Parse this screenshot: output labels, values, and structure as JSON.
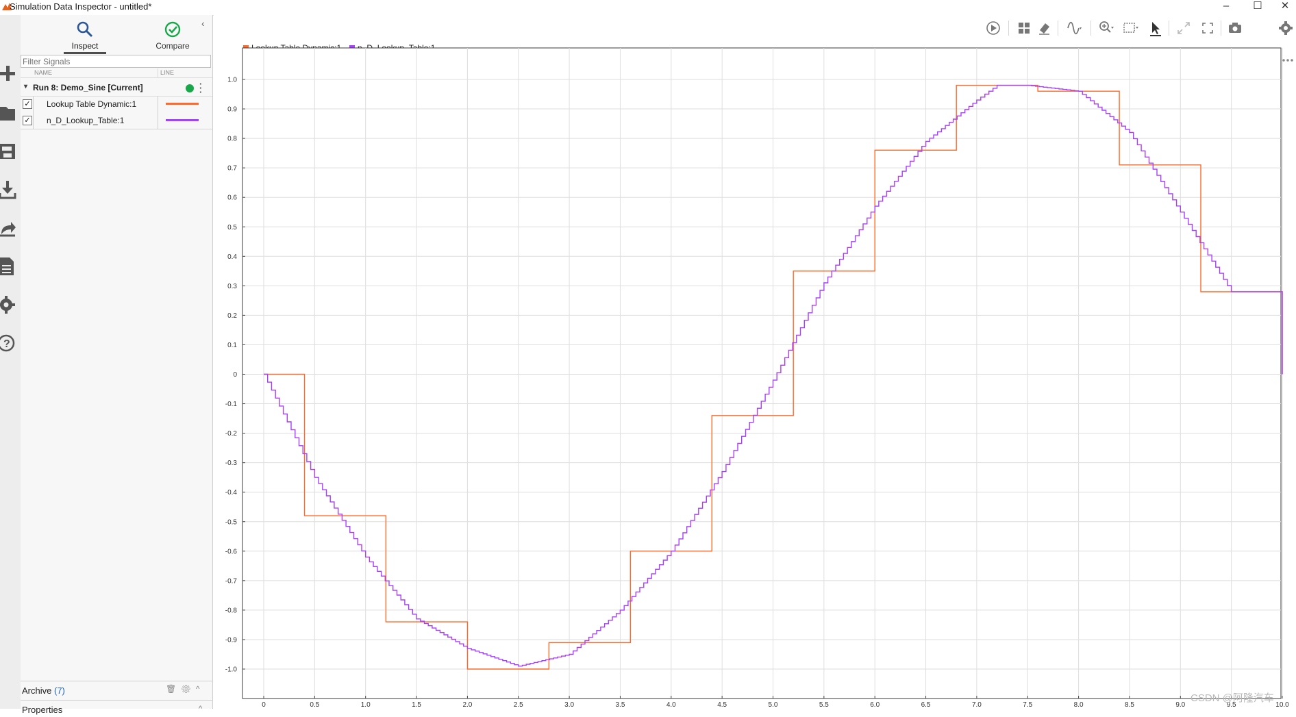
{
  "window": {
    "title": "Simulation Data Inspector - untitled*",
    "minimize": "–",
    "maximize": "☐",
    "close": "✕"
  },
  "rail": {
    "icons": [
      "add-icon",
      "folder-open-icon",
      "save-icon",
      "import-icon",
      "share-icon",
      "report-icon",
      "settings-icon",
      "help-icon"
    ]
  },
  "tabs": {
    "inspect": "Inspect",
    "compare": "Compare"
  },
  "filter": {
    "placeholder": "Filter Signals"
  },
  "columns": {
    "name": "NAME",
    "line": "LINE"
  },
  "run": {
    "label": "Run 8: Demo_Sine [Current]",
    "status_color": "#17a84a"
  },
  "signals": [
    {
      "name": "Lookup Table Dynamic:1",
      "checked": true,
      "color": "#ff6a2a"
    },
    {
      "name": "n_D_Lookup_Table:1",
      "checked": true,
      "color": "#a83ffc"
    }
  ],
  "archive": {
    "label": "Archive",
    "count": "(7)"
  },
  "properties": {
    "label": "Properties"
  },
  "toolbar": {
    "icons": [
      "play-icon",
      "layout-grid-icon",
      "eraser-icon",
      "signal-wave-icon",
      "zoom-in-icon",
      "fit-icon",
      "cursor-icon",
      "expand-icon",
      "fullscreen-icon",
      "camera-icon",
      "gear-icon"
    ]
  },
  "watermark": "CSDN @阿隆汽车",
  "chart_data": {
    "type": "line",
    "title": "",
    "xlabel": "",
    "ylabel": "",
    "xlim": [
      0,
      10
    ],
    "ylim": [
      -1.0,
      1.0
    ],
    "grid": true,
    "legend_position": "top-left",
    "x_ticks": [
      "0",
      "0.5",
      "1.0",
      "1.5",
      "2.0",
      "2.5",
      "3.0",
      "3.5",
      "4.0",
      "4.5",
      "5.0",
      "5.5",
      "6.0",
      "6.5",
      "7.0",
      "7.5",
      "8.0",
      "8.5",
      "9.0",
      "9.5",
      "10.0"
    ],
    "y_ticks": [
      "1.0",
      "0.9",
      "0.8",
      "0.7",
      "0.6",
      "0.5",
      "0.4",
      "0.3",
      "0.2",
      "0.1",
      "0",
      "-0.1",
      "-0.2",
      "-0.3",
      "-0.4",
      "-0.5",
      "-0.6",
      "-0.7",
      "-0.8",
      "-0.9",
      "-1.0"
    ],
    "series": [
      {
        "name": "Lookup Table Dynamic:1",
        "color": "#ff6a2a",
        "style": "step",
        "x": [
          0,
          0.4,
          0.4,
          1.2,
          1.2,
          2.0,
          2.0,
          2.8,
          2.8,
          3.6,
          3.6,
          4.4,
          4.4,
          5.2,
          5.2,
          6.0,
          6.0,
          6.8,
          6.8,
          7.6,
          7.6,
          8.4,
          8.4,
          9.2,
          9.2,
          10.0,
          10.0
        ],
        "y": [
          0,
          0,
          -0.48,
          -0.48,
          -0.84,
          -0.84,
          -1.0,
          -1.0,
          -0.91,
          -0.91,
          -0.6,
          -0.6,
          -0.14,
          -0.14,
          0.35,
          0.35,
          0.76,
          0.76,
          0.98,
          0.98,
          0.96,
          0.96,
          0.71,
          0.71,
          0.28,
          0.28,
          0
        ]
      },
      {
        "name": "n_D_Lookup_Table:1",
        "color": "#a83ffc",
        "style": "line",
        "x": [
          0,
          0.5,
          1.0,
          1.5,
          2.0,
          2.5,
          3.0,
          3.5,
          4.0,
          4.5,
          5.0,
          5.5,
          6.0,
          6.5,
          7.0,
          7.2,
          7.5,
          8.0,
          8.5,
          9.0,
          9.5,
          10.0,
          10.0
        ],
        "y": [
          0,
          -0.35,
          -0.62,
          -0.83,
          -0.93,
          -0.99,
          -0.95,
          -0.8,
          -0.6,
          -0.33,
          -0.02,
          0.31,
          0.57,
          0.79,
          0.93,
          0.98,
          0.98,
          0.96,
          0.82,
          0.55,
          0.28,
          0.28,
          0
        ]
      }
    ]
  }
}
